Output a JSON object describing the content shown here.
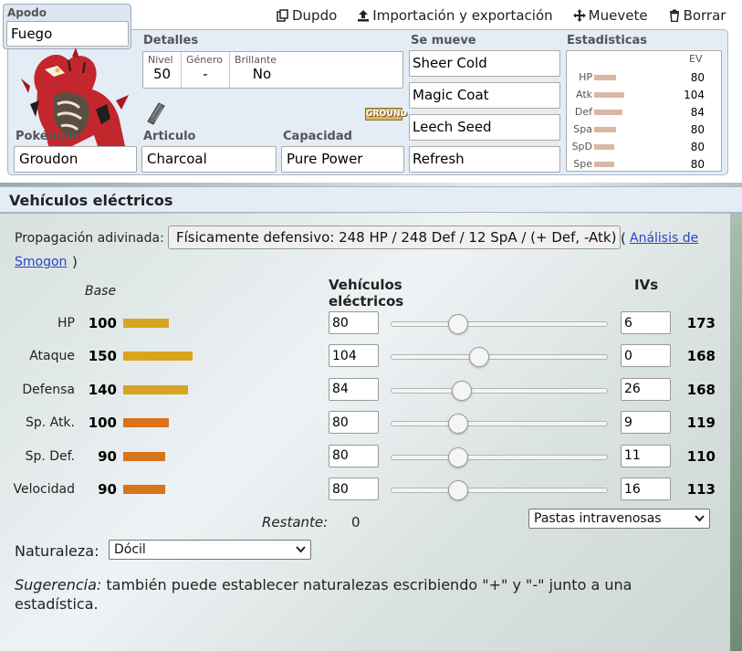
{
  "actions": {
    "duplicate": "Dupdo",
    "import_export": "Importación y exportación",
    "move": "Muevete",
    "delete": "Borrar"
  },
  "nickname": {
    "label": "Apodo",
    "value": "Fuego"
  },
  "details": {
    "label": "Detalles",
    "level_label": "Nivel",
    "level": "50",
    "gender_label": "Género",
    "gender": "-",
    "shiny_label": "Brillante",
    "shiny": "No"
  },
  "pokemon": {
    "label": "Pokémon",
    "value": "Groudon",
    "type_badge": "GROUND",
    "type_color": "#d7b665"
  },
  "item": {
    "label": "Articulo",
    "value": "Charcoal",
    "icon": "charcoal-icon"
  },
  "ability": {
    "label": "Capacidad",
    "value": "Pure Power"
  },
  "moves": {
    "label": "Se mueve",
    "list": [
      "Sheer Cold",
      "Magic Coat",
      "Leech Seed",
      "Refresh"
    ]
  },
  "stats_summary": {
    "label": "Estadisticas",
    "ev_header": "EV",
    "rows": [
      {
        "name": "HP",
        "ev": "80",
        "bar_fraction": 0.4
      },
      {
        "name": "Atk",
        "ev": "104",
        "bar_fraction": 0.55
      },
      {
        "name": "Def",
        "ev": "84",
        "bar_fraction": 0.52
      },
      {
        "name": "Spa",
        "ev": "80",
        "bar_fraction": 0.4
      },
      {
        "name": "SpD",
        "ev": "80",
        "bar_fraction": 0.36
      },
      {
        "name": "Spe",
        "ev": "80",
        "bar_fraction": 0.36
      }
    ]
  },
  "section": {
    "title": "Vehículos eléctricos"
  },
  "spread": {
    "label": "Propagación adivinada:",
    "value": "Físicamente defensivo: 248 HP / 248 Def / 12 SpA / (+ Def, -Atk)",
    "paren_open": "(",
    "link_1": "Análisis de",
    "link_2": "Smogon",
    "paren_close": ")"
  },
  "columns": {
    "base": "Base",
    "evs_1": "Vehículos",
    "evs_2": "eléctricos",
    "ivs": "IVs"
  },
  "stat_rows": [
    {
      "name": "HP",
      "base": "100",
      "base_fraction": 0.36,
      "bar_color": "#d9a521",
      "ev": "80",
      "ev_fraction": 0.313,
      "iv": "6",
      "total": "173"
    },
    {
      "name": "Ataque",
      "base": "150",
      "base_fraction": 0.54,
      "bar_color": "#d9a521",
      "ev": "104",
      "ev_fraction": 0.408,
      "iv": "0",
      "total": "168"
    },
    {
      "name": "Defensa",
      "base": "140",
      "base_fraction": 0.51,
      "bar_color": "#d9a521",
      "ev": "84",
      "ev_fraction": 0.329,
      "iv": "26",
      "total": "168"
    },
    {
      "name": "Sp. Atk.",
      "base": "100",
      "base_fraction": 0.36,
      "bar_color": "#d9731c",
      "ev": "80",
      "ev_fraction": 0.313,
      "iv": "9",
      "total": "119"
    },
    {
      "name": "Sp. Def.",
      "base": "90",
      "base_fraction": 0.33,
      "bar_color": "#d9731c",
      "ev": "80",
      "ev_fraction": 0.313,
      "iv": "11",
      "total": "110"
    },
    {
      "name": "Velocidad",
      "base": "90",
      "base_fraction": 0.33,
      "bar_color": "#d9731c",
      "ev": "80",
      "ev_fraction": 0.313,
      "iv": "16",
      "total": "113"
    }
  ],
  "remaining": {
    "label": "Restante:",
    "value": "0"
  },
  "iv_preset": {
    "value": "Pastas intravenosas"
  },
  "nature": {
    "label": "Naturaleza:",
    "value": "Dócil"
  },
  "hint": {
    "prefix": "Sugerencia:",
    "text": " también puede establecer naturalezas escribiendo \"+\" y \"-\" junto a una estadística."
  }
}
